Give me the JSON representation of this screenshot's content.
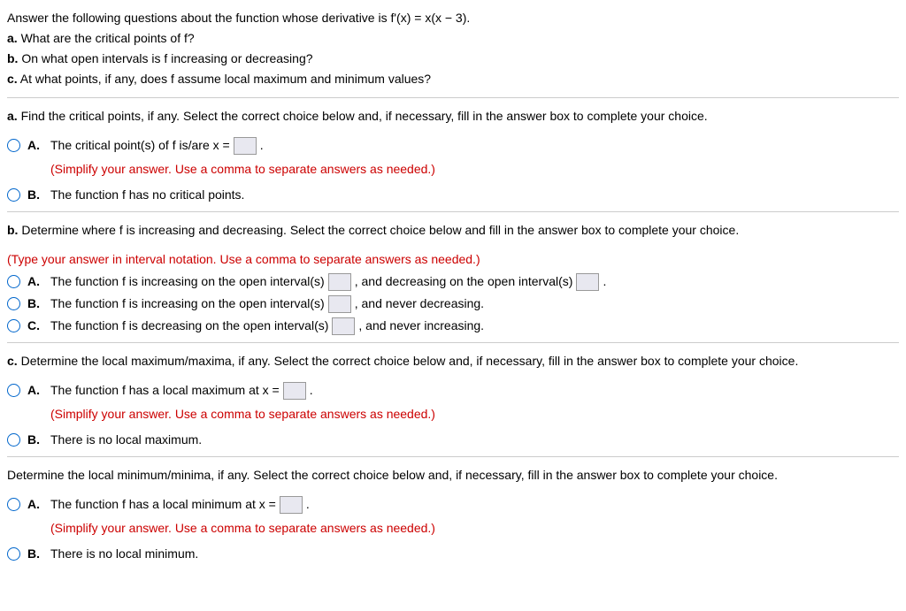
{
  "header": {
    "intro": "Answer the following questions about the function whose derivative is f'(x) = x(x − 3).",
    "a": "a. What are the critical points of f?",
    "b": "b. On what open intervals is f increasing or decreasing?",
    "c": "c. At what points, if any, does f assume local maximum and minimum values?"
  },
  "partA": {
    "prompt_bold": "a.",
    "prompt": " Find the critical points, if any. Select the correct choice below and, if necessary, fill in the answer box to complete your choice.",
    "optA": {
      "label": "A.",
      "text1": "The critical point(s) of f is/are x =",
      "text2": ".",
      "help": "(Simplify your answer. Use a comma to separate answers as needed.)"
    },
    "optB": {
      "label": "B.",
      "text": "The function f has no critical points."
    }
  },
  "partB": {
    "prompt_bold": "b.",
    "prompt": " Determine where f is increasing and decreasing. Select the correct choice below and fill in the answer box to complete your choice.",
    "help": "(Type your answer in interval notation. Use a comma to separate answers as needed.)",
    "optA": {
      "label": "A.",
      "text1": "The function f is increasing on the open interval(s)",
      "text2": ", and decreasing on the open interval(s)",
      "text3": "."
    },
    "optB": {
      "label": "B.",
      "text1": "The function f is increasing on the open interval(s)",
      "text2": ", and never decreasing."
    },
    "optC": {
      "label": "C.",
      "text1": "The function f is decreasing on the open interval(s)",
      "text2": ", and never increasing."
    }
  },
  "partC_max": {
    "prompt_bold": "c.",
    "prompt": " Determine the local maximum/maxima, if any. Select the correct choice below and, if necessary, fill in the answer box to complete your choice.",
    "optA": {
      "label": "A.",
      "text1": "The function f has a local maximum at x =",
      "text2": ".",
      "help": "(Simplify your answer. Use a comma to separate answers as needed.)"
    },
    "optB": {
      "label": "B.",
      "text": "There is no local maximum."
    }
  },
  "partC_min": {
    "prompt": "Determine the local minimum/minima, if any. Select the correct choice below and, if necessary, fill in the answer box to complete your choice.",
    "optA": {
      "label": "A.",
      "text1": "The function f has a local minimum at x =",
      "text2": ".",
      "help": "(Simplify your answer. Use a comma to separate answers as needed.)"
    },
    "optB": {
      "label": "B.",
      "text": "There is no local minimum."
    }
  }
}
